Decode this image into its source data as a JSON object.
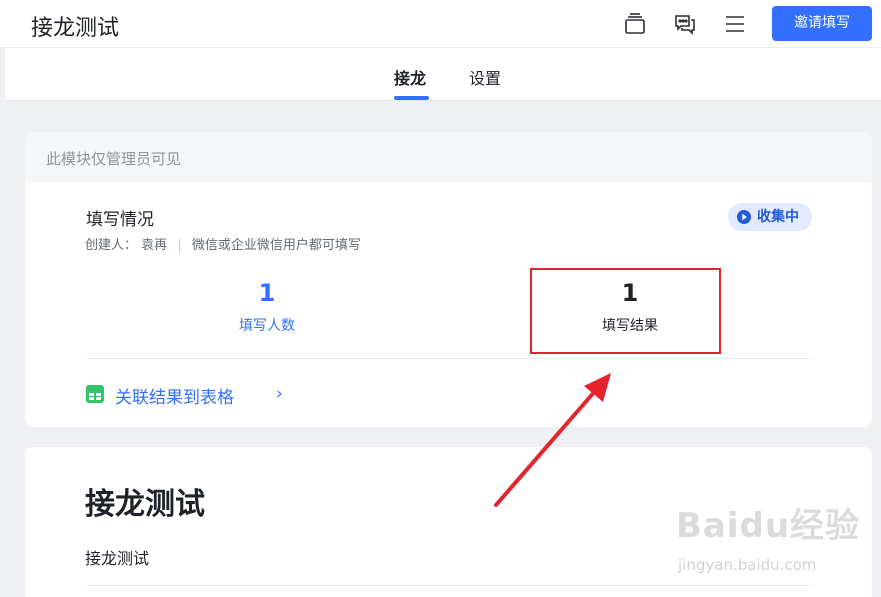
{
  "header": {
    "title": "接龙测试",
    "invite_label": "邀请填写",
    "icons": [
      "window-stack-icon",
      "chat-bubbles-icon",
      "menu-icon"
    ]
  },
  "tabs": [
    {
      "label": "接龙",
      "active": true
    },
    {
      "label": "设置",
      "active": false
    }
  ],
  "admin_card": {
    "notice": "此模块仅管理员可见",
    "title": "填写情况",
    "creator_label": "创建人：",
    "creator_name": "袁再",
    "scope": "微信或企业微信用户都可填写",
    "status": "收集中",
    "stats": [
      {
        "value": "1",
        "label": "填写人数",
        "color": "#3370ff"
      },
      {
        "value": "1",
        "label": "填写结果",
        "color": "#1f2329"
      }
    ],
    "link_label": "关联结果到表格",
    "link_chevron": "›"
  },
  "content_card": {
    "title": "接龙测试",
    "description": "接龙测试"
  },
  "watermark": {
    "logo": "Baidu经验",
    "url": "jingyan.baidu.com"
  },
  "colors": {
    "accent": "#3370ff",
    "annotation": "#e5232c"
  }
}
